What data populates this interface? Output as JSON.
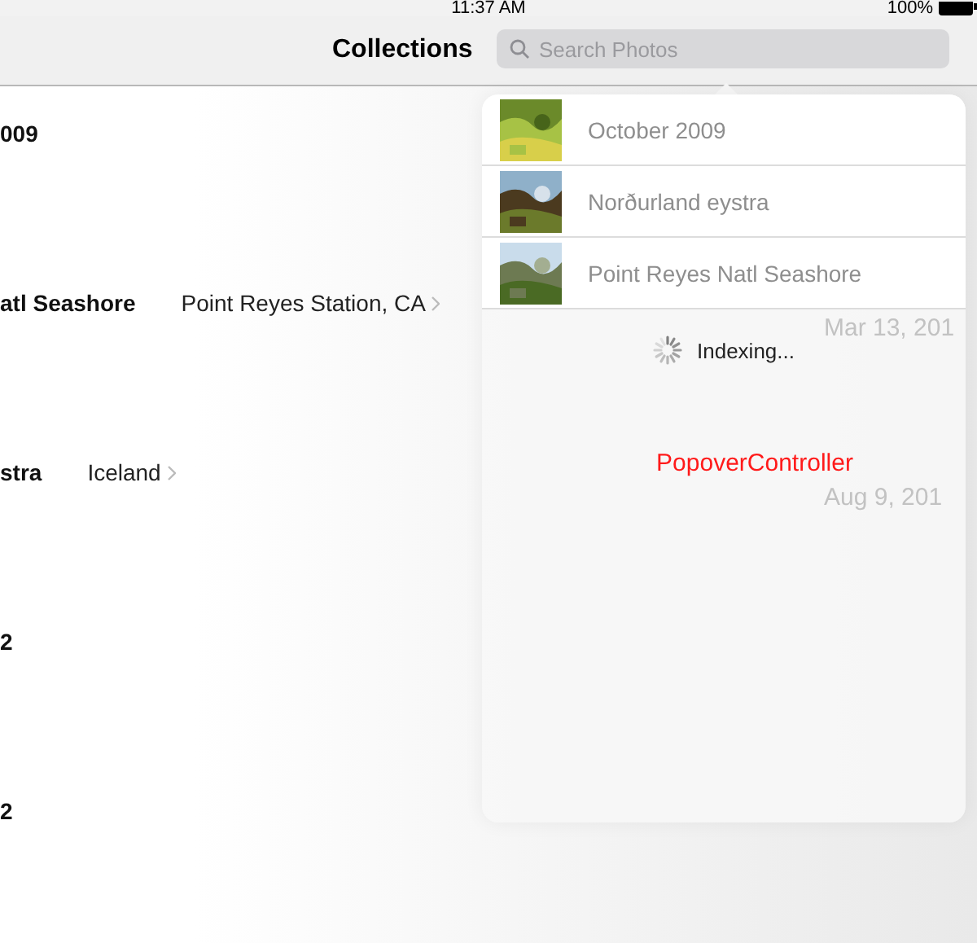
{
  "status_bar": {
    "time": "11:37 AM",
    "battery": "100%"
  },
  "nav_bar": {
    "title": "Collections",
    "search": {
      "placeholder": "Search Photos"
    }
  },
  "collections": [
    {
      "title": "009"
    },
    {
      "title": "atl Seashore",
      "location": "Point Reyes Station, CA",
      "date": "Mar 13, 201"
    },
    {
      "title": "stra",
      "location": "Iceland",
      "date": "Aug 9, 201"
    },
    {
      "title": "2"
    },
    {
      "title": "2"
    }
  ],
  "popover": {
    "results": [
      {
        "title": "October 2009",
        "kind": "picture"
      },
      {
        "title": "Norðurland eystra",
        "kind": "picture"
      },
      {
        "title": "Point Reyes Natl Seashore",
        "kind": "picture"
      }
    ],
    "status": "Indexing...",
    "caption": "PopoverController"
  }
}
